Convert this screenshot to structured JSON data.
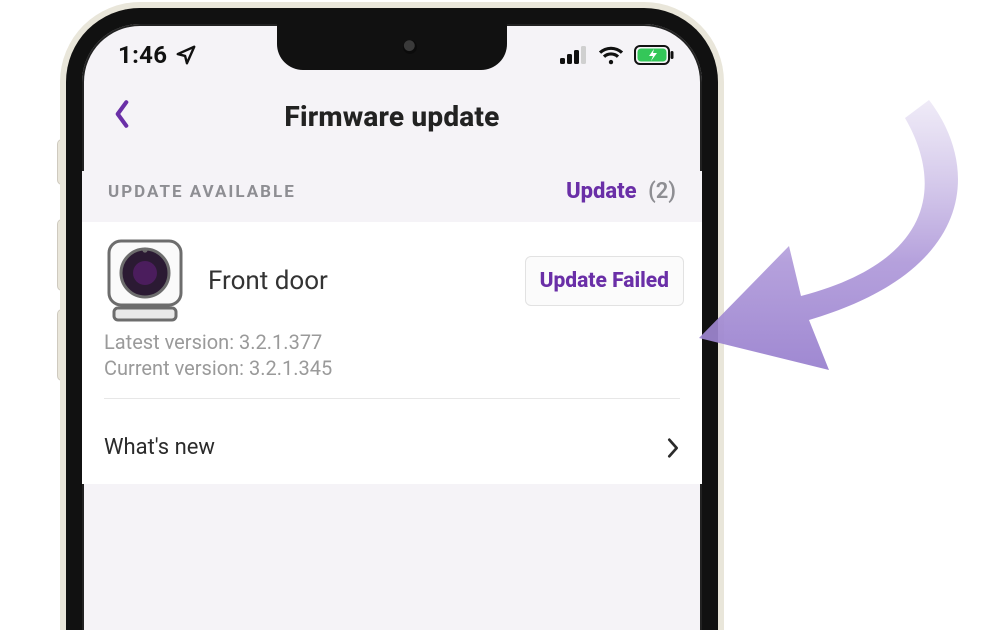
{
  "statusbar": {
    "time": "1:46",
    "location_icon": "location-arrow-icon",
    "signal_icon": "cell-signal-icon",
    "wifi_icon": "wifi-icon",
    "battery_icon": "battery-charging-icon"
  },
  "header": {
    "back_icon": "chevron-left-icon",
    "title": "Firmware update"
  },
  "section": {
    "label": "UPDATE AVAILABLE",
    "action_label": "Update",
    "action_count": "(2)"
  },
  "device": {
    "icon": "camera-device-icon",
    "name": "Front door",
    "badge": "Update Failed",
    "latest_label": "Latest version:",
    "latest_version": "3.2.1.377",
    "current_label": "Current version:",
    "current_version": "3.2.1.345"
  },
  "whatsnew": {
    "label": "What's new",
    "chevron": "chevron-right-icon"
  },
  "annotation": {
    "arrow": "callout-arrow-icon"
  },
  "colors": {
    "accent": "#6a2fa7",
    "battery": "#34c759"
  }
}
